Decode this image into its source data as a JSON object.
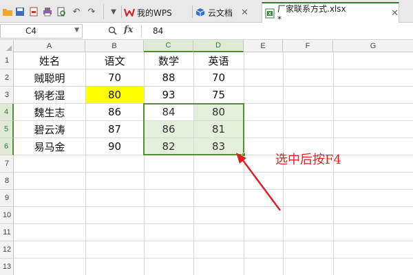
{
  "tabs": [
    {
      "label": "我的WPS",
      "icon": "wps-logo-icon"
    },
    {
      "label": "云文档",
      "icon": "cloud-doc-icon"
    },
    {
      "label": "厂家联系方式.xlsx *",
      "icon": "spreadsheet-file-icon",
      "active": true
    }
  ],
  "formula_bar": {
    "name_box": "C4",
    "fx_label": "fx",
    "value": "84"
  },
  "sheet": {
    "columns": [
      "A",
      "B",
      "C",
      "D",
      "E",
      "F",
      "G"
    ],
    "rows": [
      "1",
      "2",
      "3",
      "4",
      "5",
      "6",
      "7",
      "8",
      "9",
      "10",
      "11",
      "12",
      "13"
    ],
    "data": [
      [
        "姓名",
        "语文",
        "数学",
        "英语"
      ],
      [
        "贼聪明",
        "70",
        "88",
        "70"
      ],
      [
        "锅老湿",
        "80",
        "93",
        "75"
      ],
      [
        "魏生志",
        "86",
        "84",
        "80"
      ],
      [
        "碧云涛",
        "87",
        "86",
        "81"
      ],
      [
        "易马金",
        "90",
        "82",
        "83"
      ]
    ],
    "highlight_cell": "B3",
    "highlight_color": "#ffff00",
    "selected_range": "C4:D6",
    "selection_color": "#4f8f2f"
  },
  "annotation": {
    "text": "选中后按F4",
    "color": "#e02020"
  }
}
